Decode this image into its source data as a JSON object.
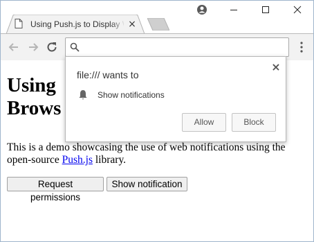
{
  "browser": {
    "tab": {
      "title": "Using Push.js to Display Web Notifications"
    },
    "tab_close_icon": "close-icon",
    "address_bar": {
      "value": "",
      "placeholder": ""
    }
  },
  "page": {
    "heading": "Using Push.js to Display Web Notifications in the Browser",
    "heading_visible_line1": "Using",
    "heading_visible_line2": "Brows",
    "description_before_link": "This is a demo showcasing the use of web notifications using the open-source ",
    "link_text": "Push.js",
    "description_after_link": " library.",
    "buttons": {
      "request_permissions": "Request permissions",
      "show_notification": "Show notification"
    }
  },
  "permission_prompt": {
    "origin_text": "file:/// wants to",
    "permission": "Show notifications",
    "allow_label": "Allow",
    "block_label": "Block"
  },
  "colors": {
    "window_border": "#9fb5cc",
    "toolbar_bg": "#f2f2f2",
    "link": "#0000ee"
  }
}
